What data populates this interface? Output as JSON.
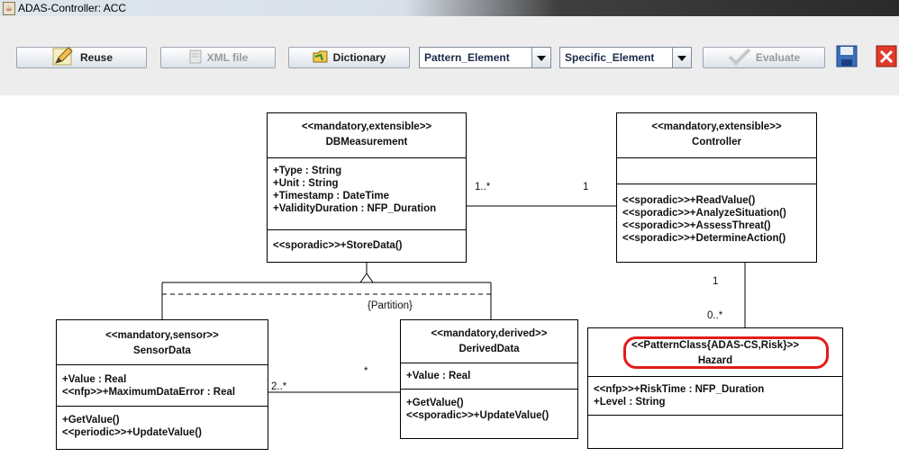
{
  "window": {
    "title": "ADAS-Controller: ACC"
  },
  "toolbar": {
    "reuse_label": "Reuse",
    "xml_label": "XML file",
    "dictionary_label": "Dictionary",
    "pattern_value": "Pattern_Element",
    "specific_value": "Specific_Element",
    "evaluate_label": "Evaluate"
  },
  "diagram": {
    "db": {
      "stereotype": "<<mandatory,extensible>>",
      "name": "DBMeasurement",
      "attributes": [
        "+Type : String",
        "+Unit : String",
        "+Timestamp : DateTime",
        "+ValidityDuration : NFP_Duration"
      ],
      "operations": [
        "<<sporadic>>+StoreData()"
      ]
    },
    "controller": {
      "stereotype": "<<mandatory,extensible>>",
      "name": "Controller",
      "operations": [
        "<<sporadic>>+ReadValue()",
        "<<sporadic>>+AnalyzeSituation()",
        "<<sporadic>>+AssessThreat()",
        "<<sporadic>>+DetermineAction()"
      ]
    },
    "sensor": {
      "stereotype": "<<mandatory,sensor>>",
      "name": "SensorData",
      "attributes": [
        "+Value : Real",
        "<<nfp>>+MaximumDataError : Real"
      ],
      "operations": [
        "+GetValue()",
        "<<periodic>>+UpdateValue()"
      ]
    },
    "derived": {
      "stereotype": "<<mandatory,derived>>",
      "name": "DerivedData",
      "attributes": [
        "+Value : Real"
      ],
      "operations": [
        "+GetValue()",
        "<<sporadic>>+UpdateValue()"
      ]
    },
    "hazard": {
      "stereotype": "<<PatternClass{ADAS-CS,Risk}>>",
      "name": "Hazard",
      "attributes": [
        "<<nfp>>+RiskTime : NFP_Duration",
        "+Level : String"
      ]
    },
    "labels": {
      "db_ctrl_left": "1..*",
      "db_ctrl_right": "1",
      "ctrl_hazard_top": "1",
      "ctrl_hazard_bottom": "0..*",
      "partition": "{Partition}",
      "sensor_mult": "2..*",
      "derived_mult": "*"
    }
  },
  "colors": {
    "highlight": "#e31b1b"
  }
}
